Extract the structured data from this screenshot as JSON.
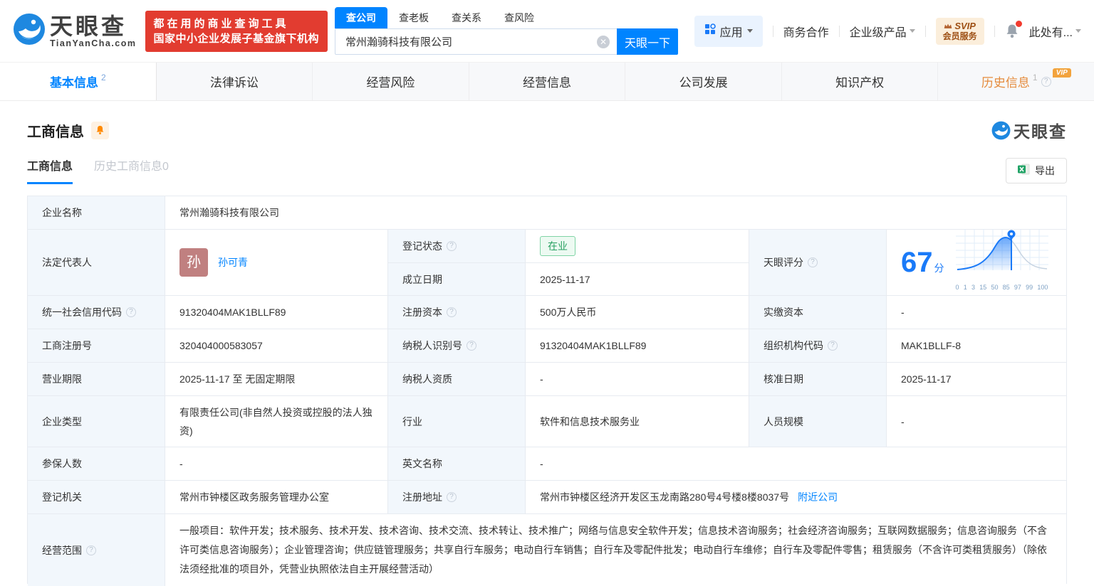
{
  "header": {
    "logo": {
      "title": "天眼查",
      "domain": "TianYanCha.com"
    },
    "promo": {
      "line1": "都在用的商业查询工具",
      "line2": "国家中小企业发展子基金旗下机构"
    },
    "search": {
      "tabs": [
        {
          "label": "查公司"
        },
        {
          "label": "查老板"
        },
        {
          "label": "查关系"
        },
        {
          "label": "查风险"
        }
      ],
      "value": "常州瀚骑科技有限公司",
      "button": "天眼一下"
    },
    "nav": {
      "apps": "应用",
      "business_coop": "商务合作",
      "enterprise_products": "企业级产品",
      "svip_line1": "SVIP",
      "svip_line2": "会员服务",
      "user": "此处有..."
    }
  },
  "tabs": [
    {
      "label": "基本信息",
      "count": "2"
    },
    {
      "label": "法律诉讼"
    },
    {
      "label": "经营风险"
    },
    {
      "label": "经营信息"
    },
    {
      "label": "公司发展"
    },
    {
      "label": "知识产权"
    },
    {
      "label": "历史信息",
      "count": "1",
      "vip": "VIP"
    }
  ],
  "section": {
    "title": "工商信息",
    "subtabs": [
      {
        "label": "工商信息"
      },
      {
        "label": "历史工商信息0"
      }
    ],
    "export_label": "导出",
    "watermark": "天眼查"
  },
  "table": {
    "company_name": {
      "label": "企业名称",
      "value": "常州瀚骑科技有限公司"
    },
    "legal_rep": {
      "label": "法定代表人",
      "avatar_char": "孙",
      "name": "孙可青"
    },
    "reg_status": {
      "label": "登记状态",
      "value": "在业"
    },
    "establish_date": {
      "label": "成立日期",
      "value": "2025-11-17"
    },
    "score": {
      "label": "天眼评分",
      "value": "67",
      "unit": "分"
    },
    "credit_code": {
      "label": "统一社会信用代码",
      "value": "91320404MAK1BLLF89"
    },
    "reg_capital": {
      "label": "注册资本",
      "value": "500万人民币"
    },
    "paid_capital": {
      "label": "实缴资本",
      "value": "-"
    },
    "reg_number": {
      "label": "工商注册号",
      "value": "320404000583057"
    },
    "taxpayer_id": {
      "label": "纳税人识别号",
      "value": "91320404MAK1BLLF89"
    },
    "org_code": {
      "label": "组织机构代码",
      "value": "MAK1BLLF-8"
    },
    "business_term": {
      "label": "营业期限",
      "value": "2025-11-17 至 无固定期限"
    },
    "taxpayer_qualification": {
      "label": "纳税人资质",
      "value": "-"
    },
    "approval_date": {
      "label": "核准日期",
      "value": "2025-11-17"
    },
    "company_type": {
      "label": "企业类型",
      "value": "有限责任公司(非自然人投资或控股的法人独资)"
    },
    "industry": {
      "label": "行业",
      "value": "软件和信息技术服务业"
    },
    "staff_size": {
      "label": "人员规模",
      "value": "-"
    },
    "insured_count": {
      "label": "参保人数",
      "value": "-"
    },
    "english_name": {
      "label": "英文名称",
      "value": "-"
    },
    "reg_authority": {
      "label": "登记机关",
      "value": "常州市钟楼区政务服务管理办公室"
    },
    "reg_address": {
      "label": "注册地址",
      "value": "常州市钟楼区经济开发区玉龙南路280号4号楼8楼8037号",
      "link": "附近公司"
    },
    "business_scope": {
      "label": "经营范围",
      "value": "一般项目：软件开发；技术服务、技术开发、技术咨询、技术交流、技术转让、技术推广；网络与信息安全软件开发；信息技术咨询服务；社会经济咨询服务；互联网数据服务；信息咨询服务（不含许可类信息咨询服务）；企业管理咨询；供应链管理服务；共享自行车服务；电动自行车销售；自行车及零配件批发；电动自行车维修；自行车及零配件零售；租赁服务（不含许可类租赁服务）（除依法须经批准的项目外，凭营业执照依法自主开展经营活动）"
    }
  },
  "chart_data": {
    "type": "area",
    "title": "天眼评分分布曲线",
    "score": 67,
    "x_ticks": [
      "0",
      "1",
      "3",
      "15",
      "50",
      "85",
      "97",
      "99",
      "100"
    ],
    "marker_between": [
      "50",
      "85"
    ],
    "legend_position": "none",
    "grid": true
  },
  "colors": {
    "brand_blue": "#0084ff",
    "promo_red": "#e23c30",
    "history_orange": "#e58c3d",
    "vip_badge": "#f2a33c",
    "open_status_green": "#28a061",
    "avatar_rose": "#c08080",
    "label_bg": "#f2f7fc"
  },
  "icons": {
    "clear": "circled-x",
    "caret": "triangle-down",
    "help": "question-circle",
    "bell": "bell",
    "crown": "crown",
    "app_grid": "grid-squares",
    "excel": "green-x-sheet",
    "pin": "location-pin"
  }
}
